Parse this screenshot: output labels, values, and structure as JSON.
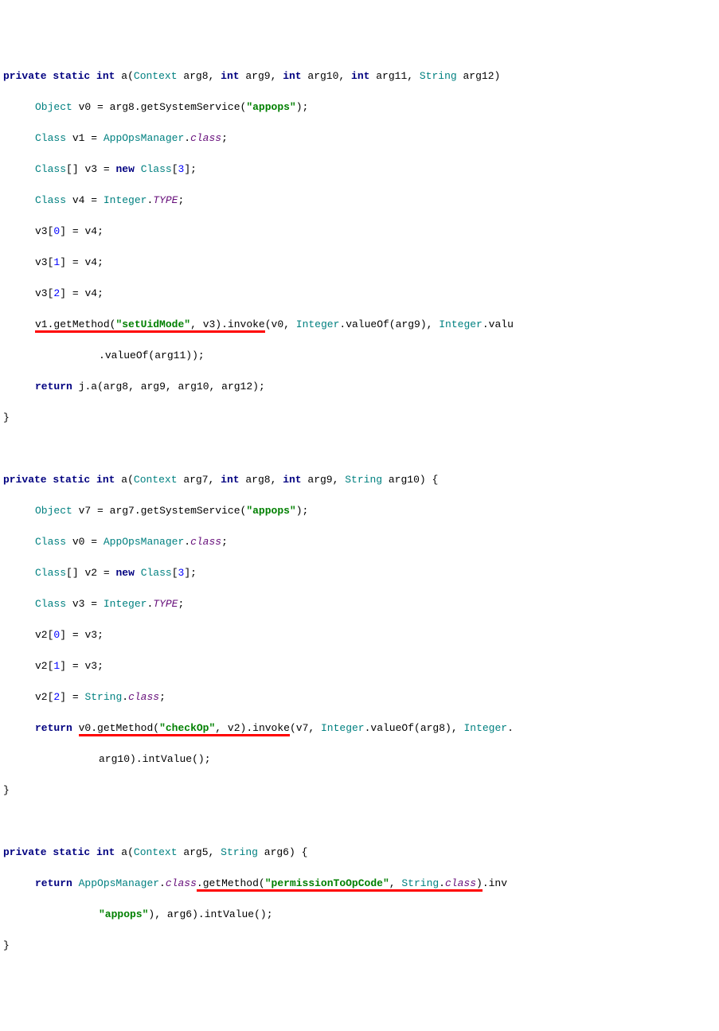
{
  "kw": {
    "private": "private",
    "static": "static",
    "int": "int",
    "new": "new",
    "return": "return"
  },
  "types": {
    "Context": "Context",
    "String": "String",
    "Object": "Object",
    "Class": "Class",
    "AppOpsManager": "AppOpsManager",
    "Integer": "Integer"
  },
  "ids": {
    "a": "a",
    "arg5": "arg5",
    "arg6": "arg6",
    "arg7": "arg7",
    "arg8": "arg8",
    "arg9": "arg9",
    "arg10": "arg10",
    "arg11": "arg11",
    "arg12": "arg12",
    "v0": "v0",
    "v1": "v1",
    "v2": "v2",
    "v3": "v3",
    "v4": "v4",
    "v7": "v7",
    "j": "j",
    "getSystemService": "getSystemService",
    "getMethod": "getMethod",
    "invoke": "invoke",
    "valueOf": "valueOf",
    "intValue": "intValue",
    "class": "class",
    "TYPE": "TYPE",
    "valu": "valu",
    "inv": "inv"
  },
  "str": {
    "appops": "\"appops\"",
    "setUidMode": "\"setUidMode\"",
    "checkOp": "\"checkOp\"",
    "permissionToOpCode": "\"permissionToOpCode\""
  },
  "num": {
    "n0": "0",
    "n1": "1",
    "n2": "2",
    "n3": "3"
  },
  "p": {
    "lbrace": "{",
    "rbrace": "}",
    "lparen": "(",
    "rparen": ")",
    "lbrack": "[",
    "rbrack": "]",
    "semi": ";",
    "dot": ".",
    "comma": ",",
    "sp": " ",
    "eq": " = ",
    "cs": ", "
  }
}
